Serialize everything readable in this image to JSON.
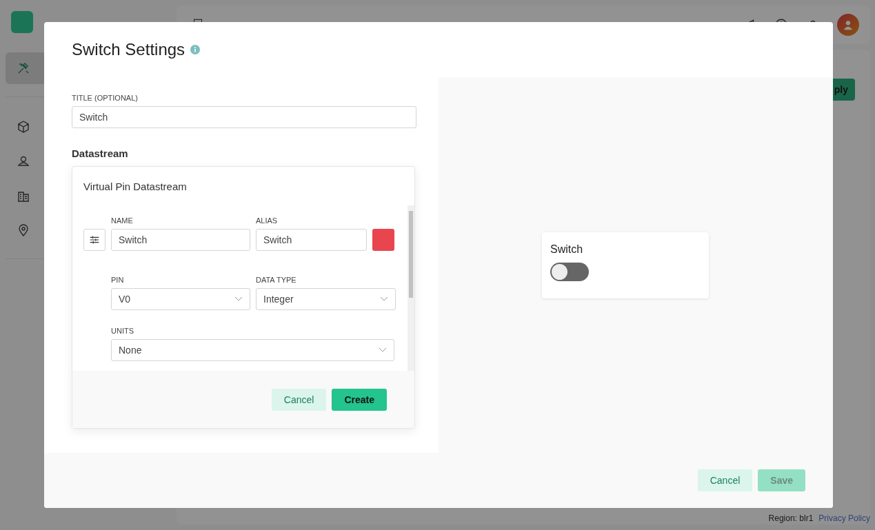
{
  "app": {
    "sidebar": {
      "items": [
        {
          "selected": true
        },
        {
          "selected": false
        },
        {
          "selected": false
        },
        {
          "selected": false
        },
        {
          "selected": false
        }
      ]
    },
    "apply_button": "ply",
    "footer": {
      "region": "Region: blr1",
      "privacy_link": "Privacy Policy"
    }
  },
  "dialog": {
    "title": "Switch Settings",
    "title_field": {
      "label": "TITLE (OPTIONAL)",
      "value": "Switch"
    },
    "datastream_heading": "Datastream",
    "datastream_card": {
      "title": "Virtual Pin Datastream",
      "name": {
        "label": "NAME",
        "value": "Switch"
      },
      "alias": {
        "label": "ALIAS",
        "value": "Switch"
      },
      "color": "#e8454f",
      "pin": {
        "label": "PIN",
        "value": "V0"
      },
      "data_type": {
        "label": "DATA TYPE",
        "value": "Integer"
      },
      "units": {
        "label": "UNITS",
        "value": "None"
      },
      "buttons": [
        {
          "label": "Cancel",
          "kind": "secondary"
        },
        {
          "label": "Create",
          "kind": "primary"
        }
      ]
    },
    "preview": {
      "widget_title": "Switch",
      "on": false
    },
    "buttons": [
      {
        "label": "Cancel",
        "kind": "secondary",
        "disabled": false
      },
      {
        "label": "Save",
        "kind": "primary",
        "disabled": true
      }
    ]
  }
}
